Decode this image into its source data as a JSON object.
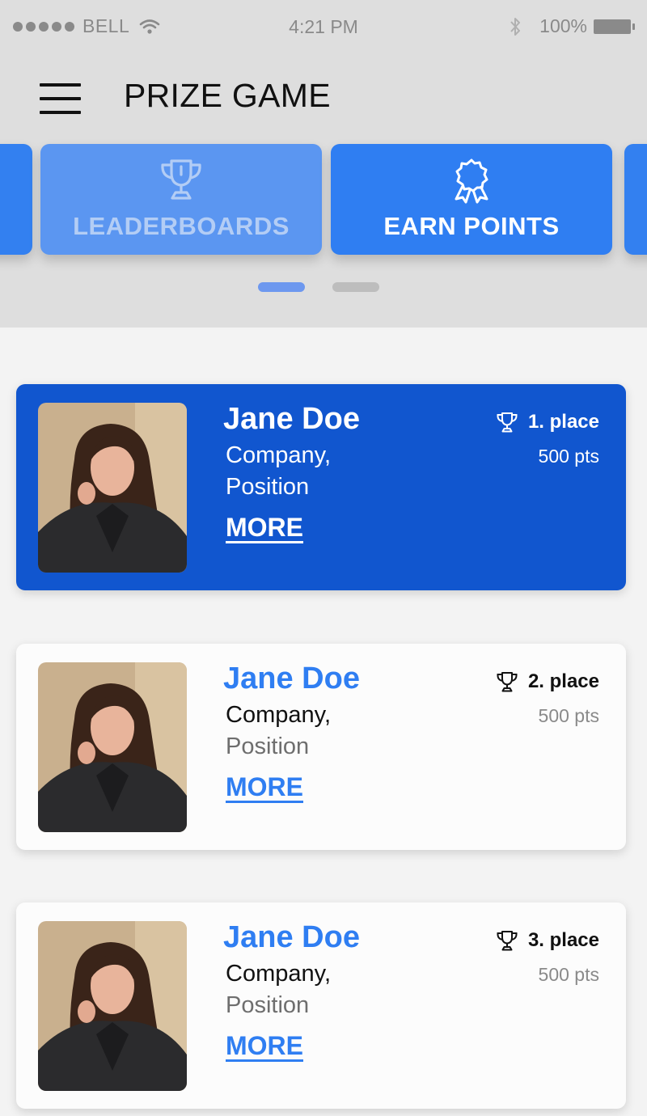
{
  "status_bar": {
    "carrier": "BELL",
    "time": "4:21 PM",
    "battery": "100%",
    "icons": [
      "signal-dots-icon",
      "wifi-icon",
      "bluetooth-icon",
      "battery-icon"
    ]
  },
  "header": {
    "title": "PRIZE GAME",
    "menu_icon": "hamburger-menu-icon"
  },
  "tiles": [
    {
      "label": "LEADERBOARDS",
      "icon": "trophy-icon"
    },
    {
      "label": "EARN POINTS",
      "icon": "award-ribbon-icon"
    }
  ],
  "pager": {
    "pages": 2,
    "active": 1
  },
  "colors": {
    "accent": "#2f7ef2",
    "highlight_card": "#1156cf",
    "top_background": "#dedede",
    "page_background": "#f3f3f3"
  },
  "leaderboard": [
    {
      "name": "Jane Doe",
      "company": "Company,",
      "position": "Position",
      "more": "MORE",
      "place": "1. place",
      "points": "500 pts",
      "highlighted": true
    },
    {
      "name": "Jane Doe",
      "company": "Company,",
      "position": "Position",
      "more": "MORE",
      "place": "2. place",
      "points": "500 pts",
      "highlighted": false
    },
    {
      "name": "Jane Doe",
      "company": "Company,",
      "position": "Position",
      "more": "MORE",
      "place": "3. place",
      "points": "500 pts",
      "highlighted": false
    }
  ]
}
